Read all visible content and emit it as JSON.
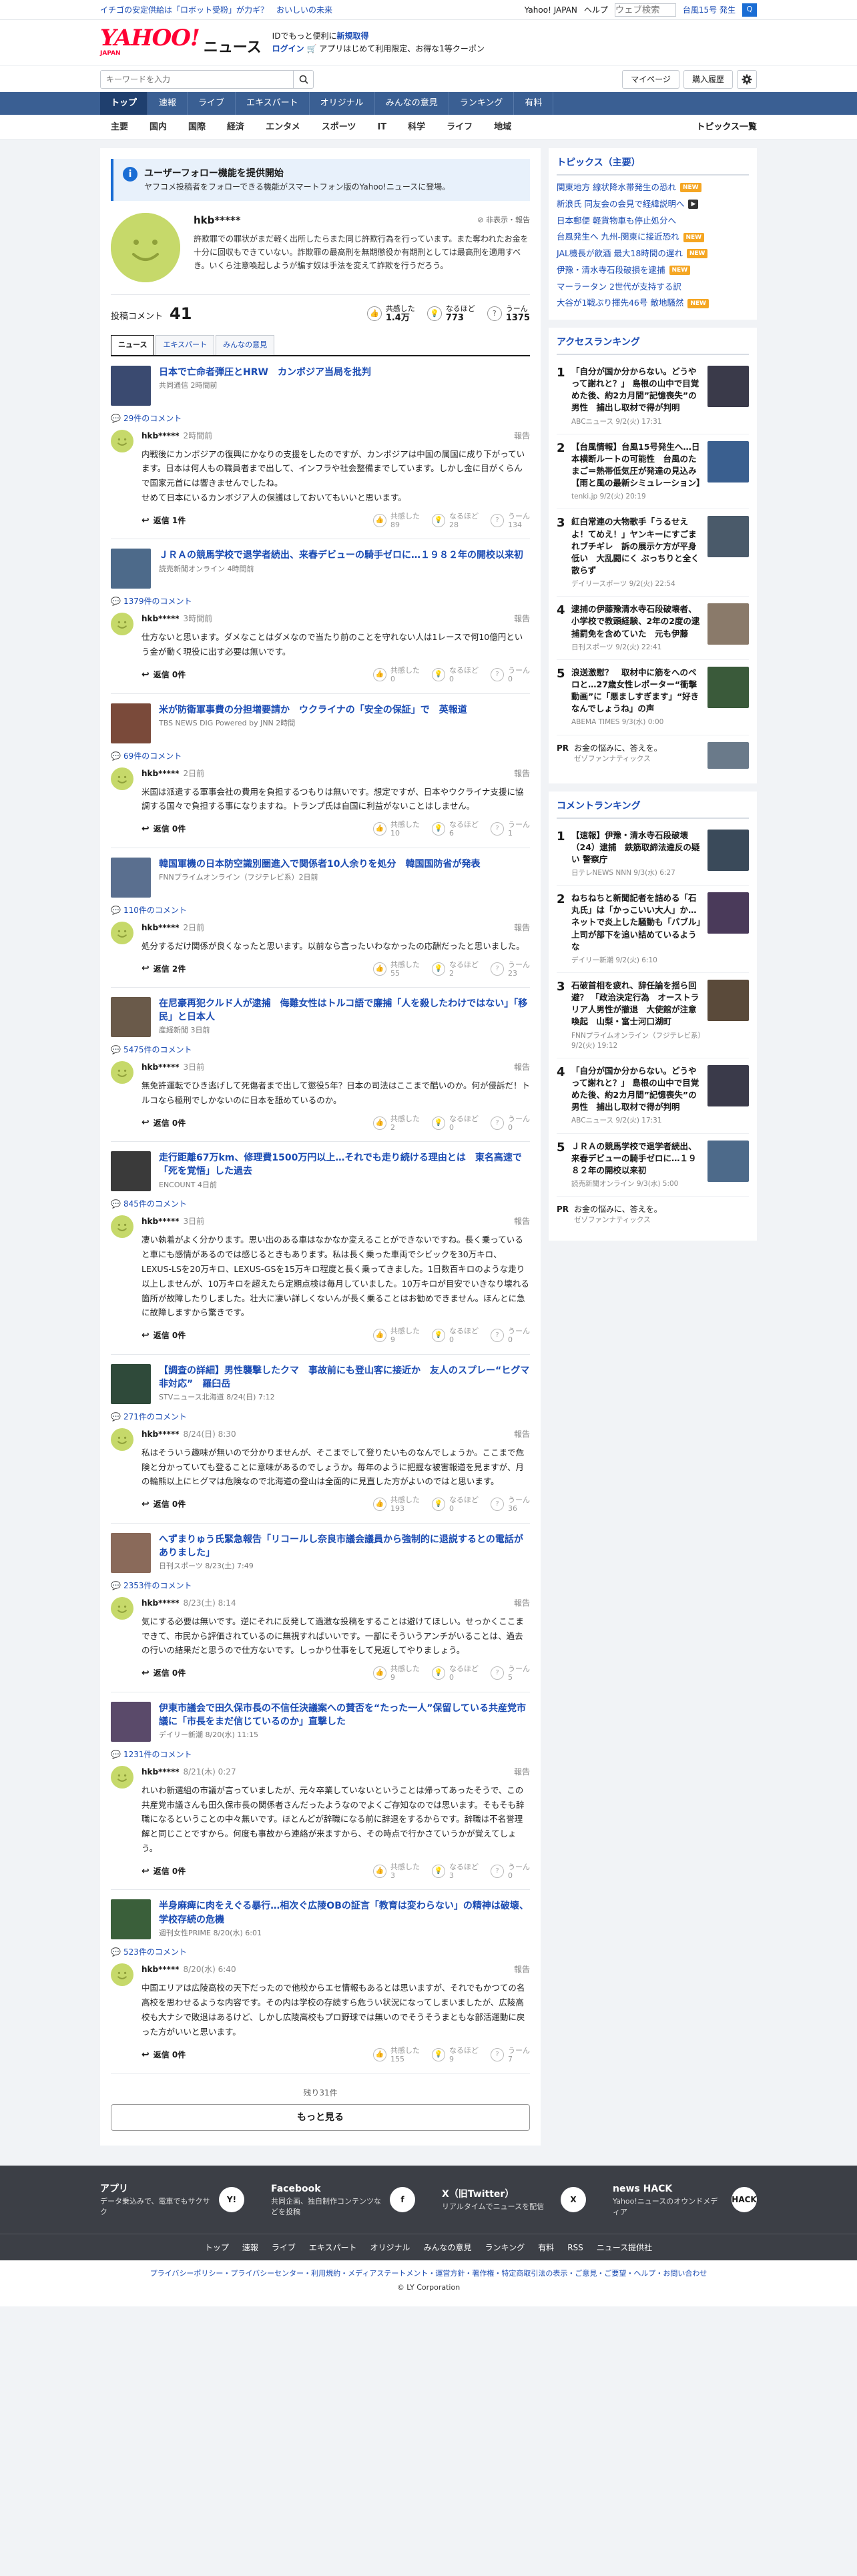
{
  "topbar": {
    "links": [
      "イチゴの安定供給は「ロボット受粉」が力ギ？",
      "おいしいの未来"
    ],
    "yahoo_japan": "Yahoo! JAPAN",
    "help": "ヘルプ",
    "search_placeholder": "ウェブ検索",
    "typhoon": "台風15号 発生",
    "search_btn": "Q"
  },
  "header": {
    "logo_y": "YAHOO!",
    "logo_jp": "JAPAN",
    "logo_news": "ニュース",
    "promo_line1_a": "IDでもっと便利に",
    "promo_line1_b": "新規取得",
    "promo_line2_a": "ログイン",
    "promo_line2_b": "アプリはじめて利用限定、お得な1等クーポン"
  },
  "search": {
    "placeholder": "キーワードを入力",
    "mypage": "マイページ",
    "purchase": "購入履歴"
  },
  "nav": [
    "トップ",
    "速報",
    "ライブ",
    "エキスパート",
    "オリジナル",
    "みんなの意見",
    "ランキング",
    "有料"
  ],
  "subnav": {
    "items": [
      "主要",
      "国内",
      "国際",
      "経済",
      "エンタメ",
      "スポーツ",
      "IT",
      "科学",
      "ライフ",
      "地域"
    ],
    "all": "トピックス一覧"
  },
  "info": {
    "title": "ユーザーフォロー機能を提供開始",
    "desc": "ヤフコメ投稿者をフォローできる機能がスマートフォン版のYahoo!ニュースに登場。"
  },
  "profile": {
    "name": "hkb*****",
    "actions": "非表示・報告",
    "desc": "許欺罪での罪状がまだ軽く出所したらまた同じ許欺行為を行っています。また奪われたお金を十分に回収もできていない。詐欺罪の最高刑を無期懲役か有期刑としては最高刑を適用すべき。いくら注意喚起しようが騙す奴は手法を変えて詐欺を行うだろう。"
  },
  "stats": {
    "label": "投稿コメント",
    "count": "41",
    "r1_label": "共感した",
    "r1_value": "1.4万",
    "r2_label": "なるほど",
    "r2_value": "773",
    "r3_label": "うーん",
    "r3_value": "1375"
  },
  "tabs": [
    "ニュース",
    "エキスパート",
    "みんなの意見"
  ],
  "entries": [
    {
      "title": "日本で亡命者弾圧とHRW　カンボジア当局を批判",
      "source": "共同通信 2時間前",
      "comments": "29件のコメント",
      "user": "hkb*****",
      "time": "2時間前",
      "text": "内戦後にカンボジアの復興にかなりの支援をしたのですが、カンボジアは中国の属国に成り下がっています。日本は何人もの職員者まで出して、インフラや社会整備までしています。しかし金に目がくらんで国家元首には響きませんでしたね。\nせめて日本にいるカンボジア人の保護はしておいてもいいと思います。",
      "reply": "返信 1件",
      "r": [
        "89",
        "28",
        "134"
      ],
      "thumb": "#3a4a70"
    },
    {
      "title": "ＪＲＡの競馬学校で退学者続出、来春デビューの騎手ゼロに…１９８２年の開校以来初",
      "source": "読売新聞オンライン 4時間前",
      "comments": "1379件のコメント",
      "user": "hkb*****",
      "time": "3時間前",
      "text": "仕方ないと思います。ダメなことはダメなので当たり前のことを守れない人は1レースで何10億円という金が動く現役に出す必要は無いです。",
      "reply": "返信 0件",
      "r": [
        "0",
        "0",
        "0"
      ],
      "thumb": "#4d6a8a"
    },
    {
      "title": "米が防衛軍事費の分担増要請か　ウクライナの「安全の保証」で　英報道",
      "source": "TBS NEWS DIG Powered by JNN 2時間",
      "comments": "69件のコメント",
      "user": "hkb*****",
      "time": "2日前",
      "text": "米国は派遣する軍事会社の費用を負担するつもりは無いです。想定ですが、日本やウクライナ支援に協調する国々で負担する事になりますね。トランプ氏は自国に利益がないことはしません。",
      "reply": "返信 0件",
      "r": [
        "10",
        "6",
        "1"
      ],
      "thumb": "#7a4a3a"
    },
    {
      "title": "韓国軍機の日本防空識別圏進入で関係者10人余りを処分　韓国国防省が発表",
      "source": "FNNプライムオンライン（フジテレビ系）2日前",
      "comments": "110件のコメント",
      "user": "hkb*****",
      "time": "2日前",
      "text": "処分するだけ関係が良くなったと思います。以前なら言ったいわなかったの応酬だったと思いました。",
      "reply": "返信 2件",
      "r": [
        "55",
        "2",
        "23"
      ],
      "thumb": "#5a6f8f"
    },
    {
      "title": "在尼豪再犯クルド人が逮捕　侮難女性はトルコ語で廉捕「人を殺したわけではない」「移民」と日本人",
      "source": "産経新聞 3日前",
      "comments": "5475件のコメント",
      "user": "hkb*****",
      "time": "3日前",
      "text": "無免許運転でひき逃げして死傷者まで出して懲役5年？日本の司法はここまで酷いのか。何が侵訴だ！トルコなら極刑でしかないのに日本を舐めているのか。",
      "reply": "返信 0件",
      "r": [
        "2",
        "0",
        "0"
      ],
      "thumb": "#6a5a4a"
    },
    {
      "title": "走行距離67万km、修理費1500万円以上…それでも走り続ける理由とは　東名高速で「死を覚悟」した過去",
      "source": "ENCOUNT 4日前",
      "comments": "845件のコメント",
      "user": "hkb*****",
      "time": "3日前",
      "text": "凄い執着がよく分かります。思い出のある車はなかなか変えることができないですね。長く乗っていると車にも感情があるのでは感じるときもあります。私は長く乗った車両でシビックを30万キロ、LEXUS-LSを20万キロ、LEXUS-GSを15万キロ程度と長く乗ってきました。1日数百キロのような走り以上しませんが、10万キロを超えたら定期点検は毎月していました。10万キロが目安でいきなり壊れる箇所が故障したりしました。壮大に凄い詳しくないんが長く乗ることはお勧めできません。ほんとに急に故障しますから驚きです。",
      "reply": "返信 0件",
      "r": [
        "9",
        "0",
        "0"
      ],
      "thumb": "#3a3a3a"
    },
    {
      "title": "【調査の詳細】男性襲撃したクマ　事故前にも登山客に接近か　友人のスプレー“ヒグマ非対応”　羅臼岳",
      "source": "STVニュース北海道 8/24(日) 7:12",
      "comments": "271件のコメント",
      "user": "hkb*****",
      "time": "8/24(日) 8:30",
      "text": "私はそういう趣味が無いので分かりませんが、そこまでして登りたいものなんでしょうか。ここまで危険と分かっていても登ることに意味があるのでしょうか。毎年のように把握な被害報道を見ますが、月の輪熊以上にヒグマは危険なので北海道の登山は全面的に見直した方がよいのではと思います。",
      "reply": "返信 0件",
      "r": [
        "193",
        "0",
        "36"
      ],
      "thumb": "#2f4a3a"
    },
    {
      "title": "へずまりゅう氏緊急報告「リコールし奈良市議会議員から強制的に退説するとの電話がありました」",
      "source": "日刊スポーツ 8/23(土) 7:49",
      "comments": "2353件のコメント",
      "user": "hkb*****",
      "time": "8/23(土) 8:14",
      "text": "気にする必要は無いです。逆にそれに反発して過激な投稿をすることは避けてほしい。せっかくここまできて、市民から評価されているのに無視すればいいです。一部にそういうアンチがいることは、過去の行いの結果だと思うので仕方ないです。しっかり仕事をして見返してやりましょう。",
      "reply": "返信 0件",
      "r": [
        "9",
        "0",
        "5"
      ],
      "thumb": "#8a6a5a"
    },
    {
      "title": "伊東市議会で田久保市長の不信任決議案への賛否を“たった一人”保留している共産党市議に「市長をまだ信じているのか」直撃した",
      "source": "デイリー新潮 8/20(水) 11:15",
      "comments": "1231件のコメント",
      "user": "hkb*****",
      "time": "8/21(木) 0:27",
      "text": "れいわ新選組の市議が言っていましたが、元々卒業していないということは帰ってあったそうで、この共産党市議さんも田久保市長の関係者さんだったようなのでよくご存知なのでは思います。そもそも辞職になるということの中々無いです。ほとんどが辞職になる前に辞退をするからです。辞職は不名誉理解と同じことですから。何度も事故から連絡が来ますから、その時点で行かさていうかが覚えてしょう。",
      "reply": "返信 0件",
      "r": [
        "3",
        "3",
        "0"
      ],
      "thumb": "#5a4a6a"
    },
    {
      "title": "半身麻痺に肉をえぐる暴行…相次ぐ広陵OBの証言「教育は変わらない」の精神は破壊、学校存続の危機",
      "source": "週刊女性PRIME 8/20(水) 6:01",
      "comments": "523件のコメント",
      "user": "hkb*****",
      "time": "8/20(水) 6:40",
      "text": "中国エリアは広陵高校の天下だったので他校からエセ情報もあるとは思いますが、それでもかつての名高校を思わせるような内容です。その内は学校の存続すら危うい状況になってしまいましたが、広陵高校も大ナシで敗退はあるけど、しかし広陵高校もプロ野球では無いのでそうそうまともな部活運動に戻った方がいいと思います。",
      "reply": "返信 0件",
      "r": [
        "155",
        "9",
        "7"
      ],
      "thumb": "#3a5f3a"
    }
  ],
  "more": {
    "remaining": "残り31件",
    "label": "もっと見る"
  },
  "side": {
    "topics_header": "トピックス（主要）",
    "topics": [
      {
        "t": "関東地方 線状降水帯発生の恐れ",
        "b": "new"
      },
      {
        "t": "新浪氏 同友会の会見で経緯説明へ",
        "b": "vid"
      },
      {
        "t": "日本郵便 軽貨物車も停止処分へ",
        "b": ""
      },
      {
        "t": "台風発生へ 九州-関東に接近恐れ",
        "b": "new"
      },
      {
        "t": "JAL機長が飲酒 最大18時間の遅れ",
        "b": "new"
      },
      {
        "t": "伊豫・清水寺石段破損を逮捕",
        "b": "new"
      },
      {
        "t": "マーラータン 2世代が支持する訳",
        "b": ""
      },
      {
        "t": "大谷が1戦ぶり揮先46号 敵地騒然",
        "b": "new"
      }
    ],
    "access_header": "アクセスランキング",
    "access": [
      {
        "n": "1",
        "t": "「自分が国か分からない。どうやって謝れと？」 島根の山中で目覚めた後、約2カ月間”記憶喪失”の男性　捕出し取材で得が判明",
        "s": "ABCニュース 9/2(火) 17:31",
        "c": "#3a3a4a"
      },
      {
        "n": "2",
        "t": "【台風情報】台風15号発生へ…日本横断ルートの可能性　台風のたまご＝熱帯低気圧が発達の見込み【雨と風の最新シミュレーション】",
        "s": "tenki.jp 9/2(火) 20:19",
        "c": "#3a5f8f"
      },
      {
        "n": "3",
        "t": "紅白常連の大物歌手「うるせえよ！てめえ！」ヤンキーにすごまれブチギレ　訴の展示ケ方が平身低い　大乱闘にく ぶっちりと全く散らず",
        "s": "デイリースポーツ 9/2(火) 22:54",
        "c": "#4a5a6a"
      },
      {
        "n": "4",
        "t": "逮捕の伊藤豫清水寺石段破壊者、小学校で教頭経験、2年の2度の逮捕罰免を含めていた　元も伊藤",
        "s": "日刊スポーツ 9/2(火) 22:41",
        "c": "#8a7a6a"
      },
      {
        "n": "5",
        "t": "浪送激慰？　取材中に筋をへのペロと…27歳女性レポーター“衝撃動画”に「悪ましすぎます」“好きなんでしょうね」の声",
        "s": "ABEMA TIMES 9/3(水) 0:00",
        "c": "#3a5a3a"
      }
    ],
    "access_pr": {
      "label": "PR",
      "t": "お金の悩みに、答えを。",
      "s": "ゼゾファンナティックス",
      "c": "#6a7a8a"
    },
    "comment_header": "コメントランキング",
    "comment": [
      {
        "n": "1",
        "t": "【速報】伊豫・清水寺石段破壊（24）逮捕　鉄筋取締法違反の疑い 警察庁",
        "s": "日テレNEWS NNN 9/3(水) 6:27",
        "c": "#3a4a5a"
      },
      {
        "n": "2",
        "t": "ねちねちと新聞記者を詰める「石丸氏」は「かっこいい大人」か…ネットで炎上した騒動も「バブル」上司が部下を追い詰めているような",
        "s": "デイリー新潮 9/2(火) 6:10",
        "c": "#4a3a5a"
      },
      {
        "n": "3",
        "t": "石破首相を疲れ、辞任論を揺ら回避？ 「政治決定行為　オーストラリア人男性が撤退　大使館が注意喚起　山梨・富士河口湖町",
        "s": "FNNプライムオンライン（フジテレビ系）9/2(火) 19:12",
        "c": "#5a4a3a"
      },
      {
        "n": "4",
        "t": "「自分が国か分からない。どうやって謝れと？」 島根の山中で目覚めた後、約2カ月間”記憶喪失”の男性　捕出し取材で得が判明",
        "s": "ABCニュース 9/2(火) 17:31",
        "c": "#3a3a4a"
      },
      {
        "n": "5",
        "t": "ＪＲＡの競馬学校で退学者続出、来春デビューの騎手ゼロに…１９８２年の開校以来初",
        "s": "読売新聞オンライン 9/3(水) 5:00",
        "c": "#4d6a8a"
      }
    ],
    "comment_pr": {
      "label": "PR",
      "t": "お金の悩みに、答えを。",
      "s": "ゼゾファンナティックス"
    }
  },
  "footer": {
    "apps": [
      {
        "name": "アプリ",
        "desc": "データ乗込みで、電車でもサクサク",
        "icon": "Y!"
      },
      {
        "name": "Facebook",
        "desc": "共同企画、独自制作コンテンツなどを投稿",
        "icon": "f"
      },
      {
        "name": "X（旧Twitter）",
        "desc": "リアルタイムでニュースを配信",
        "icon": "X"
      },
      {
        "name": "news HACK",
        "desc": "Yahoo!ニュースのオウンドメディア",
        "icon": "HACK"
      }
    ],
    "nav": [
      "トップ",
      "速報",
      "ライブ",
      "エキスパート",
      "オリジナル",
      "みんなの意見",
      "ランキング",
      "有料",
      "RSS",
      "ニュース提供社"
    ],
    "links": "プライバシーポリシー・プライバシーセンター・利用規約・メディアステートメント・運営方針・著作権・特定商取引法の表示・ご意見・ご要望・ヘルプ・お問い合わせ",
    "copyright": "© LY Corporation"
  }
}
